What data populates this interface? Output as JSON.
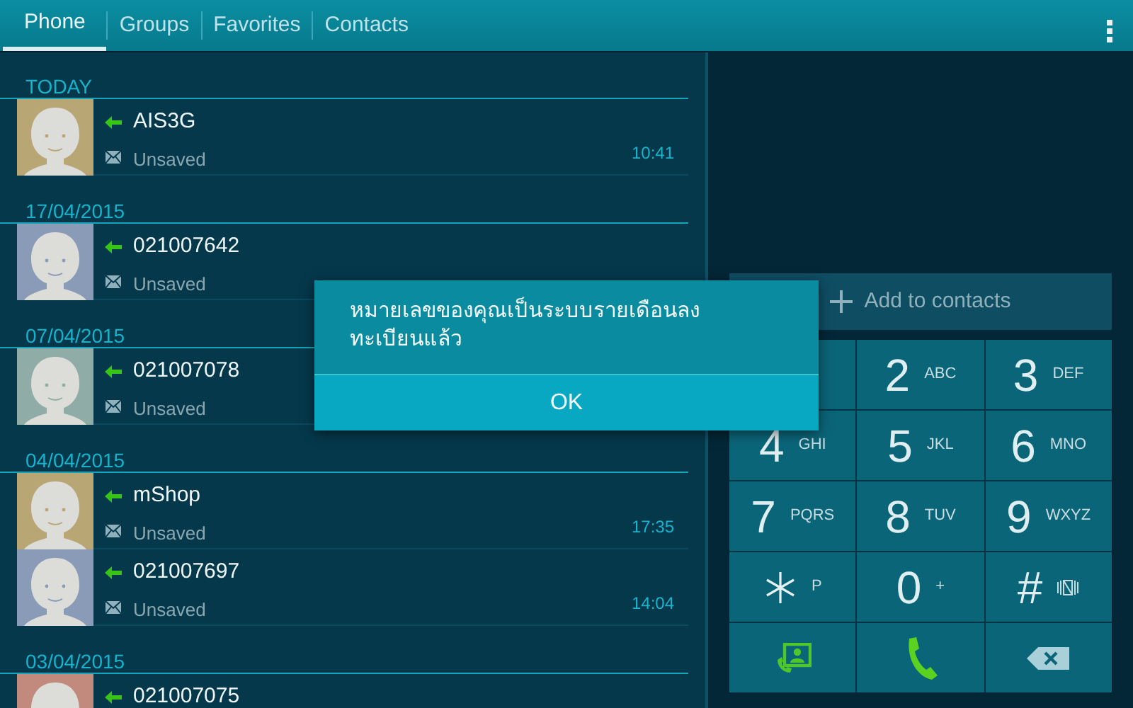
{
  "tabs": [
    {
      "label": "Phone",
      "selected": true
    },
    {
      "label": "Groups",
      "selected": false
    },
    {
      "label": "Favorites",
      "selected": false
    },
    {
      "label": "Contacts",
      "selected": false
    }
  ],
  "call_log": [
    {
      "date": "TODAY",
      "entries": [
        {
          "name": "AIS3G",
          "label": "Unsaved",
          "time": "10:41",
          "color": "#b8a774"
        }
      ]
    },
    {
      "date": "17/04/2015",
      "entries": [
        {
          "name": "021007642",
          "label": "Unsaved",
          "color": "#8a9bb8"
        }
      ]
    },
    {
      "date": "07/04/2015",
      "entries": [
        {
          "name": "021007078",
          "label": "Unsaved",
          "color": "#8fada6"
        }
      ]
    },
    {
      "date": "04/04/2015",
      "entries": [
        {
          "name": "mShop",
          "label": "Unsaved",
          "time": "17:35",
          "color": "#b8a774"
        },
        {
          "name": "021007697",
          "label": "Unsaved",
          "time": "14:04",
          "color": "#8a9bb8"
        }
      ]
    },
    {
      "date": "03/04/2015",
      "entries": [
        {
          "name": "021007075",
          "color": "#c28a7c"
        }
      ]
    }
  ],
  "dialer": {
    "add_contact": "Add to contacts",
    "keys": [
      {
        "kind": "blank"
      },
      {
        "kind": "digit",
        "digit": "2",
        "letters": "ABC"
      },
      {
        "kind": "digit",
        "digit": "3",
        "letters": "DEF"
      },
      {
        "kind": "digit",
        "digit": "4",
        "letters": "GHI"
      },
      {
        "kind": "digit",
        "digit": "5",
        "letters": "JKL"
      },
      {
        "kind": "digit",
        "digit": "6",
        "letters": "MNO"
      },
      {
        "kind": "digit",
        "digit": "7",
        "letters": "PQRS"
      },
      {
        "kind": "digit",
        "digit": "8",
        "letters": "TUV"
      },
      {
        "kind": "digit",
        "digit": "9",
        "letters": "WXYZ"
      },
      {
        "kind": "star",
        "letters": "P"
      },
      {
        "kind": "digit",
        "digit": "0",
        "letters": "+"
      },
      {
        "kind": "hash",
        "digit": "#"
      },
      {
        "kind": "contacts"
      },
      {
        "kind": "call"
      },
      {
        "kind": "backspace"
      }
    ]
  },
  "dialog": {
    "message": "หมายเลขของคุณเป็นระบบรายเดือนลงทะเบียนแล้ว",
    "button": "OK"
  }
}
